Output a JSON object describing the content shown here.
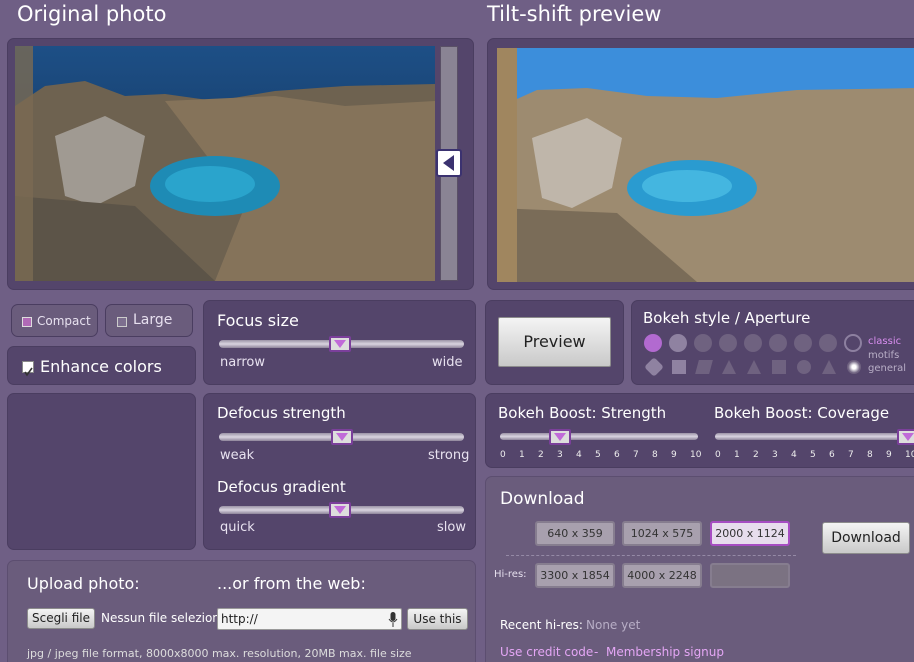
{
  "headings": {
    "original": "Original photo",
    "preview": "Tilt-shift preview"
  },
  "view": {
    "compact": "Compact",
    "large": "Large",
    "enhance": "Enhance colors"
  },
  "focus": {
    "title": "Focus size",
    "min": "narrow",
    "max": "wide"
  },
  "defocus": {
    "title": "Defocus strength",
    "min": "weak",
    "max": "strong"
  },
  "gradient": {
    "title": "Defocus gradient",
    "min": "quick",
    "max": "slow"
  },
  "preview_button": "Preview",
  "bokeh": {
    "title": "Bokeh style / Aperture",
    "legend": [
      "classic",
      "motifs",
      "general"
    ]
  },
  "boost": {
    "strength_title": "Bokeh Boost: Strength",
    "coverage_title": "Bokeh Boost: Coverage",
    "ticks": [
      "0",
      "1",
      "2",
      "3",
      "4",
      "5",
      "6",
      "7",
      "8",
      "9",
      "10"
    ],
    "strength_value": 3,
    "coverage_value": 10
  },
  "download": {
    "title": "Download",
    "sizes": [
      "640 x 359",
      "1024 x 575",
      "2000 x 1124"
    ],
    "selected": "2000 x 1124",
    "hires_label": "Hi-res:",
    "hires_sizes": [
      "3300 x 1854",
      "4000 x 2248",
      ""
    ],
    "button": "Download"
  },
  "upload": {
    "title": "Upload photo:",
    "web_title": "...or from the web:",
    "file_button": "Scegli file",
    "file_status": "Nessun file selezionato",
    "url_value": "http://",
    "use_button": "Use this",
    "note": "jpg / jpeg file format, 8000x8000 max. resolution, 20MB max. file size"
  },
  "recent": {
    "label": "Recent hi-res:",
    "value": "None yet"
  },
  "links": {
    "credit": "Use credit code",
    "separator": "-",
    "membership": "Membership signup"
  },
  "icons": {
    "mic": "microphone-icon",
    "handle": "arrow-left-icon",
    "checkbox": "checkbox-checked-icon"
  }
}
